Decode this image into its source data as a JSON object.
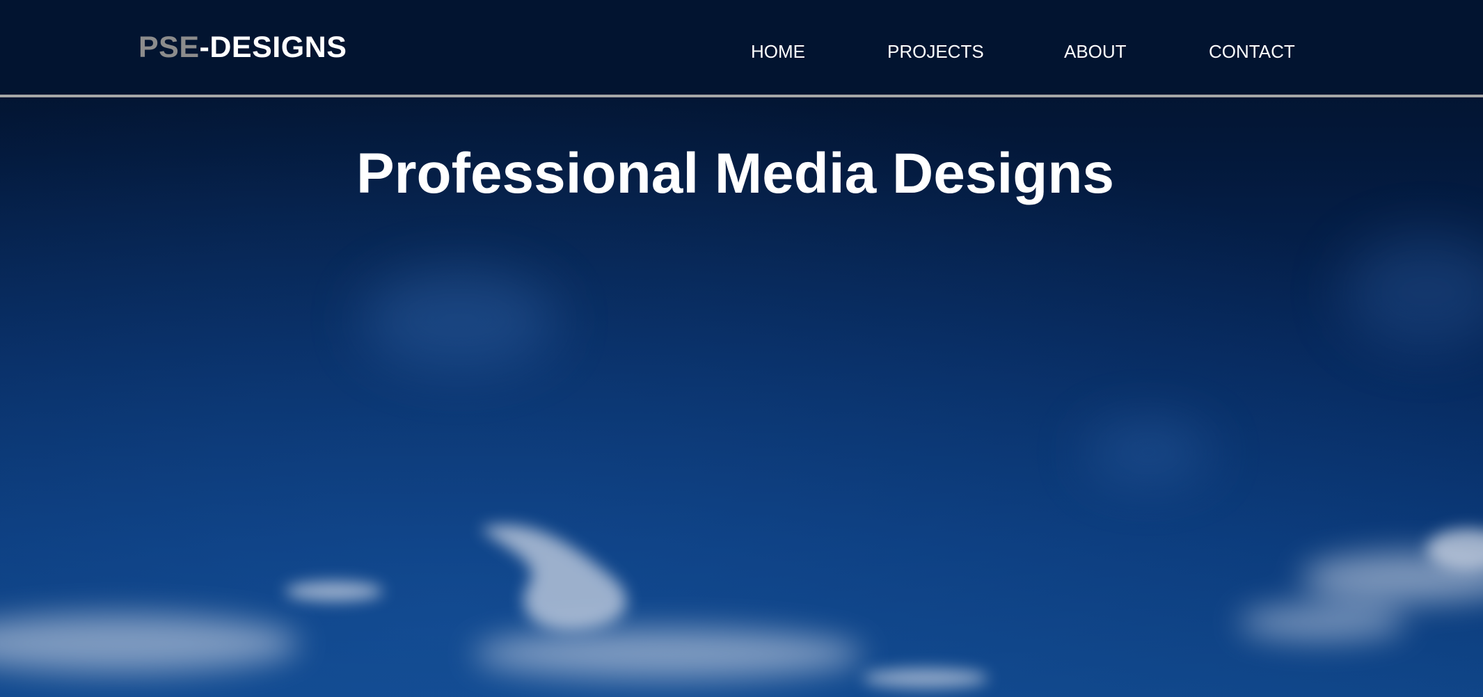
{
  "header": {
    "logo": {
      "part_a": "PSE",
      "part_b": "-DESIGNS"
    },
    "nav": {
      "items": [
        {
          "label": "HOME"
        },
        {
          "label": "PROJECTS"
        },
        {
          "label": "ABOUT"
        },
        {
          "label": "CONTACT"
        }
      ]
    }
  },
  "hero": {
    "title": "Professional Media Designs",
    "background": "sky-clouds-image"
  },
  "colors": {
    "header_bg": "#021430",
    "header_border": "#a6a6a6",
    "logo_accent": "#8c8c8c",
    "text": "#ffffff",
    "sky_dark": "#021026",
    "sky_light": "#0f4486"
  }
}
